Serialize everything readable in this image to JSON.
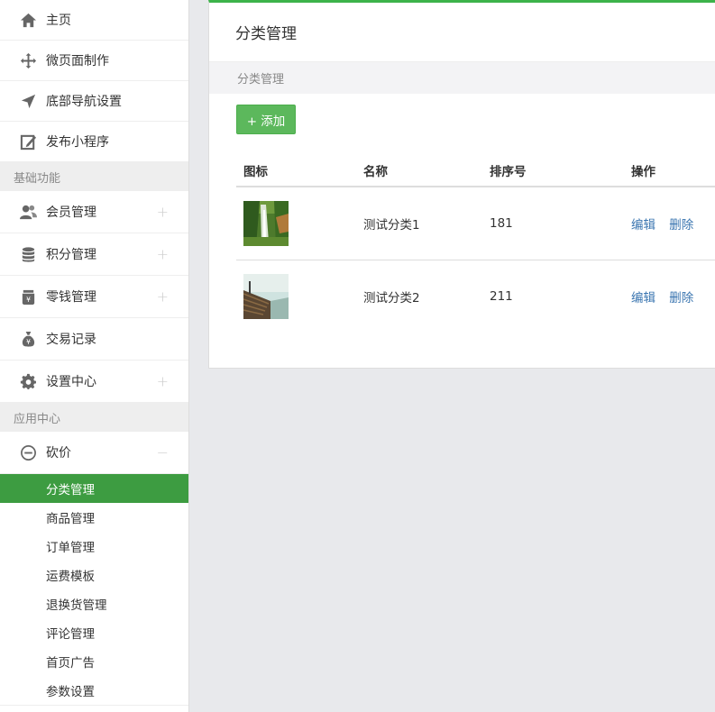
{
  "sidebar": {
    "top_items": [
      {
        "label": "主页",
        "icon": "home-icon"
      },
      {
        "label": "微页面制作",
        "icon": "move-icon"
      },
      {
        "label": "底部导航设置",
        "icon": "navigation-arrow-icon"
      },
      {
        "label": "发布小程序",
        "icon": "edit-icon"
      }
    ],
    "section_basic": "基础功能",
    "basic_items": [
      {
        "label": "会员管理",
        "icon": "users-icon",
        "expander": "+"
      },
      {
        "label": "积分管理",
        "icon": "database-icon",
        "expander": "+"
      },
      {
        "label": "零钱管理",
        "icon": "wallet-icon",
        "expander": "+"
      },
      {
        "label": "交易记录",
        "icon": "money-bag-icon"
      },
      {
        "label": "设置中心",
        "icon": "gear-icon",
        "expander": "+"
      }
    ],
    "section_apps": "应用中心",
    "app_group": {
      "label": "砍价",
      "icon": "minus-circle-icon",
      "expander": "−"
    },
    "sub_items": [
      {
        "label": "分类管理",
        "active": true
      },
      {
        "label": "商品管理"
      },
      {
        "label": "订单管理"
      },
      {
        "label": "运费模板"
      },
      {
        "label": "退换货管理"
      },
      {
        "label": "评论管理"
      },
      {
        "label": "首页广告"
      },
      {
        "label": "参数设置"
      }
    ]
  },
  "main": {
    "title": "分类管理",
    "breadcrumb": "分类管理",
    "add_button": "+ 添加",
    "columns": [
      "图标",
      "名称",
      "排序号",
      "操作"
    ],
    "rows": [
      {
        "name": "测试分类1",
        "sort": "181",
        "edit": "编辑",
        "delete": "删除",
        "thumb": "waterfall-thumbnail"
      },
      {
        "name": "测试分类2",
        "sort": "211",
        "edit": "编辑",
        "delete": "删除",
        "thumb": "railway-thumbnail"
      }
    ]
  },
  "colors": {
    "accent_green": "#3cb34a",
    "active_nav": "#3d9c41",
    "button_green": "#5cb85c",
    "link_blue": "#3a75b0"
  }
}
